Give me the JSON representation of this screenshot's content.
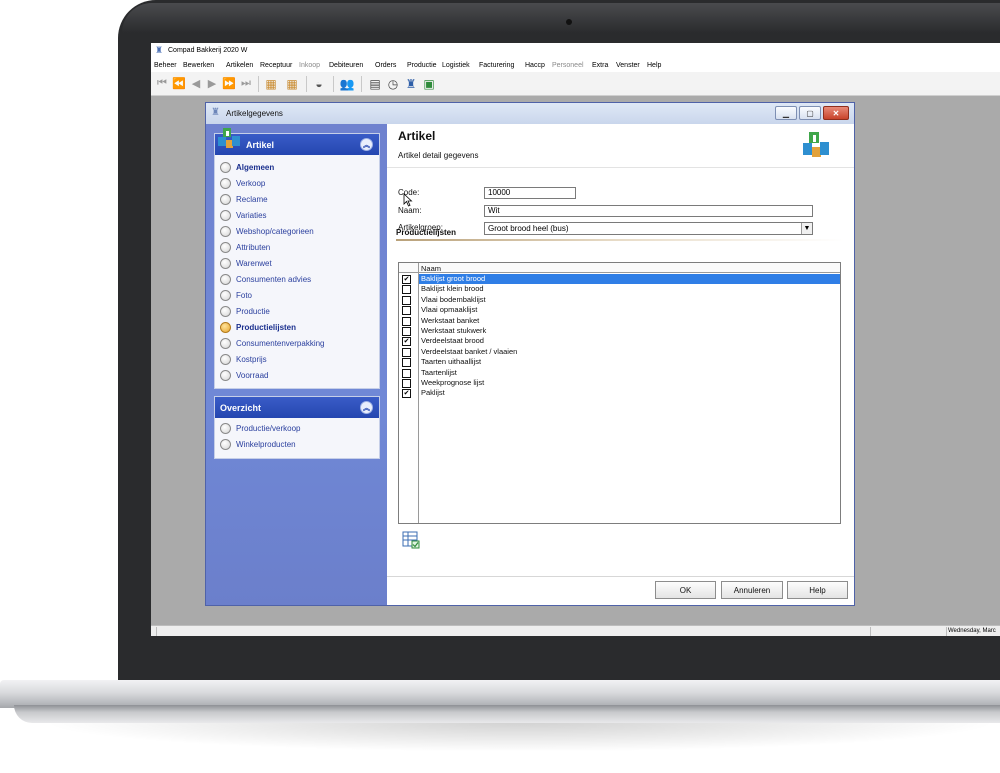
{
  "app": {
    "title": "Compad Bakkerij 2020 W"
  },
  "menu": [
    {
      "label": "Beheer",
      "enabled": true
    },
    {
      "label": "Bewerken",
      "enabled": true
    },
    {
      "label": "Artikelen",
      "enabled": true
    },
    {
      "label": "Receptuur",
      "enabled": true
    },
    {
      "label": "Inkoop",
      "enabled": false
    },
    {
      "label": "Debiteuren",
      "enabled": true
    },
    {
      "label": "Orders",
      "enabled": true
    },
    {
      "label": "Productie",
      "enabled": true
    },
    {
      "label": "Logistiek",
      "enabled": true
    },
    {
      "label": "Facturering",
      "enabled": true
    },
    {
      "label": "Haccp",
      "enabled": true
    },
    {
      "label": "Personeel",
      "enabled": false
    },
    {
      "label": "Extra",
      "enabled": true
    },
    {
      "label": "Venster",
      "enabled": true
    },
    {
      "label": "Help",
      "enabled": true
    }
  ],
  "statusbar": {
    "date_text": "Wednesday, Marc"
  },
  "dialog": {
    "title": "Artikelgegevens",
    "sidebar": {
      "artikel_header": "Artikel",
      "items": [
        {
          "label": "Algemeen",
          "bold": true,
          "selected": false
        },
        {
          "label": "Verkoop",
          "bold": false,
          "selected": false
        },
        {
          "label": "Reclame",
          "bold": false,
          "selected": false
        },
        {
          "label": "Variaties",
          "bold": false,
          "selected": false
        },
        {
          "label": "Webshop/categorieen",
          "bold": false,
          "selected": false
        },
        {
          "label": "Attributen",
          "bold": false,
          "selected": false
        },
        {
          "label": "Warenwet",
          "bold": false,
          "selected": false
        },
        {
          "label": "Consumenten advies",
          "bold": false,
          "selected": false
        },
        {
          "label": "Foto",
          "bold": false,
          "selected": false
        },
        {
          "label": "Productie",
          "bold": false,
          "selected": false
        },
        {
          "label": "Productielijsten",
          "bold": true,
          "selected": true
        },
        {
          "label": "Consumentenverpakking",
          "bold": false,
          "selected": false
        },
        {
          "label": "Kostprijs",
          "bold": false,
          "selected": false
        },
        {
          "label": "Voorraad",
          "bold": false,
          "selected": false
        }
      ],
      "overzicht_header": "Overzicht",
      "overzicht_items": [
        {
          "label": "Productie/verkoop"
        },
        {
          "label": "Winkelproducten"
        }
      ]
    },
    "header": {
      "title": "Artikel",
      "subtitle": "Artikel detail gegevens"
    },
    "form": {
      "code_label": "Code:",
      "code_value": "10000",
      "naam_label": "Naam:",
      "naam_value": "Wit",
      "groep_label": "Artikelgroep:",
      "groep_value": "Groot brood heel (bus)"
    },
    "section_title": "Productielijsten",
    "grid": {
      "column_header": "Naam",
      "rows": [
        {
          "name": "Baklijst groot brood",
          "checked": true,
          "selected": true
        },
        {
          "name": "Baklijst klein brood",
          "checked": false,
          "selected": false
        },
        {
          "name": "Vlaai bodembaklijst",
          "checked": false,
          "selected": false
        },
        {
          "name": "Vlaai opmaaklijst",
          "checked": false,
          "selected": false
        },
        {
          "name": "Werkstaat banket",
          "checked": false,
          "selected": false
        },
        {
          "name": "Werkstaat stukwerk",
          "checked": false,
          "selected": false
        },
        {
          "name": "Verdeelstaat brood",
          "checked": true,
          "selected": false
        },
        {
          "name": "Verdeelstaat banket / vlaaien",
          "checked": false,
          "selected": false
        },
        {
          "name": "Taarten uithaallijst",
          "checked": false,
          "selected": false
        },
        {
          "name": "Taartenlijst",
          "checked": false,
          "selected": false
        },
        {
          "name": "Weekprognose lijst",
          "checked": false,
          "selected": false
        },
        {
          "name": "Paklijst",
          "checked": true,
          "selected": false
        }
      ]
    },
    "buttons": {
      "ok": "OK",
      "cancel": "Annuleren",
      "help": "Help"
    }
  },
  "colors": {
    "accent_blue": "#2446b0",
    "selection": "#2f7ee6",
    "sidebar_bg": "#7088d6"
  }
}
